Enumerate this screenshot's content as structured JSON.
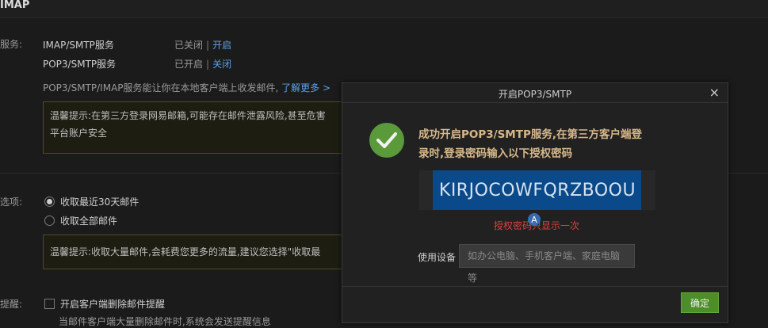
{
  "page": {
    "section_title": "IMAP"
  },
  "services": {
    "label": "服务:",
    "imap_smtp": {
      "name": "IMAP/SMTP服务",
      "status": "已关闭",
      "action": "开启"
    },
    "pop3_smtp": {
      "name": "POP3/SMTP服务",
      "status": "已开启",
      "action": "关闭"
    },
    "desc": "POP3/SMTP/IMAP服务能让你在本地客户端上收发邮件,",
    "learn_more": "了解更多 >",
    "tip": "温馨提示:在第三方登录网易邮箱,可能存在邮件泄露风险,甚至危害",
    "tip2": "平台账户安全"
  },
  "receive": {
    "label": "选项:",
    "option1": "收取最近30天邮件",
    "option2": "收取全部邮件",
    "tip": "温馨提示:收取大量邮件,会耗费您更多的流量,建议您选择\"收取最"
  },
  "reminder": {
    "label": "提醒:",
    "checkbox_label": "开启客户端删除邮件提醒",
    "desc": "当邮件客户端大量删除邮件时,系统会发送提醒信息"
  },
  "modal": {
    "title": "开启POP3/SMTP",
    "close": "×",
    "success_line1": "成功开启POP3/SMTP服务,在第三方客户端登",
    "success_line2": "录时,登录密码输入以下授权密码",
    "auth_code": "KIRJOCOWFQRZBOOU",
    "auth_note": "授权密码只显示一次",
    "device_label": "使用设备",
    "device_placeholder": "如办公电脑、手机客户端、家庭电脑等",
    "ok_button": "确定"
  },
  "icons": {
    "success": "check-circle-icon",
    "cursor": "cursor-icon",
    "close": "close-icon"
  },
  "colors": {
    "link": "#5aa0e6",
    "success_green": "#5a9a3a",
    "code_selection": "#0a4a8a",
    "warn_red": "#e04040",
    "ok_button": "#4e8e2a"
  }
}
